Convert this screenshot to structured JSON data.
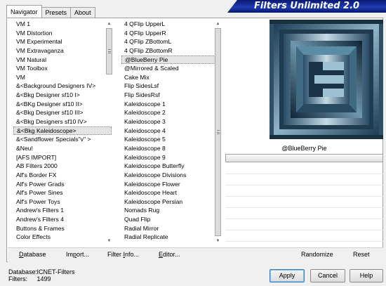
{
  "tabs": [
    {
      "label": "Navigator",
      "active": true
    },
    {
      "label": "Presets",
      "active": false
    },
    {
      "label": "About",
      "active": false
    }
  ],
  "banner_title": "Filters Unlimited 2.0",
  "categories": [
    "VM 1",
    "VM Distortion",
    "VM Experimental",
    "VM Extravaganza",
    "VM Natural",
    "VM Toolbox",
    "VM",
    "&<Background Designers IV>",
    "&<Bkg Designer sf10 I>",
    "&<BKg Designer sf10 II>",
    "&<Bkg Designer sf10 III>",
    "&<Bkg Designers sf10 IV>",
    "&<Bkg Kaleidoscope>",
    "&<Sandflower Specials\"v\" >",
    "&Neu!",
    "[AFS IMPORT]",
    "AB Filters 2000",
    "Alf's Border FX",
    "Alf's Power Grads",
    "Alf's Power Sines",
    "Alf's Power Toys",
    "Andrew's Filters 1",
    "Andrew's Filters 4",
    "Buttons & Frames",
    "Color Effects"
  ],
  "selected_category": "&<Bkg Kaleidoscope>",
  "filters": [
    "4 QFlip UpperL",
    "4 QFlip UpperR",
    "4 QFlip ZBottomL",
    "4 QFlip ZBottomR",
    "@BlueBerry Pie",
    "@Mirrored & Scaled",
    "Cake Mix",
    "Flip SidesLsf",
    "Flip SidesRsf",
    "Kaleidoscope 1",
    "Kaleidoscope 2",
    "Kaleidoscope 3",
    "Kaleidoscope 4",
    "Kaleidoscope 5",
    "Kaleidoscope 8",
    "Kaleidoscope 9",
    "Kaleidoscope Butterfly",
    "Kaleidoscope Divisions",
    "Kaleidoscope Flower",
    "Kaleidoscope Heart",
    "Kaleidoscope Persian",
    "Nomads Rug",
    "Quad Flip",
    "Radial Mirror",
    "Radial Replicate"
  ],
  "selected_filter": "@BlueBerry Pie",
  "current_filter_name": "@BlueBerry Pie",
  "bottom_links": {
    "database": {
      "u": "D",
      "rest": "atabase"
    },
    "import": {
      "pre": "Im",
      "u": "p",
      "rest": "ort..."
    },
    "filter_info": {
      "pre": "Filter ",
      "u": "I",
      "rest": "nfo..."
    },
    "editor": {
      "u": "E",
      "rest": "ditor..."
    },
    "randomize": "Randomize",
    "reset": "Reset"
  },
  "db_info": {
    "database_label": "Database:",
    "database_value": "ICNET-Filters",
    "filters_label": "Filters:",
    "filters_value": "1499"
  },
  "buttons": {
    "apply": "Apply",
    "cancel": "Cancel",
    "help": "Help"
  }
}
